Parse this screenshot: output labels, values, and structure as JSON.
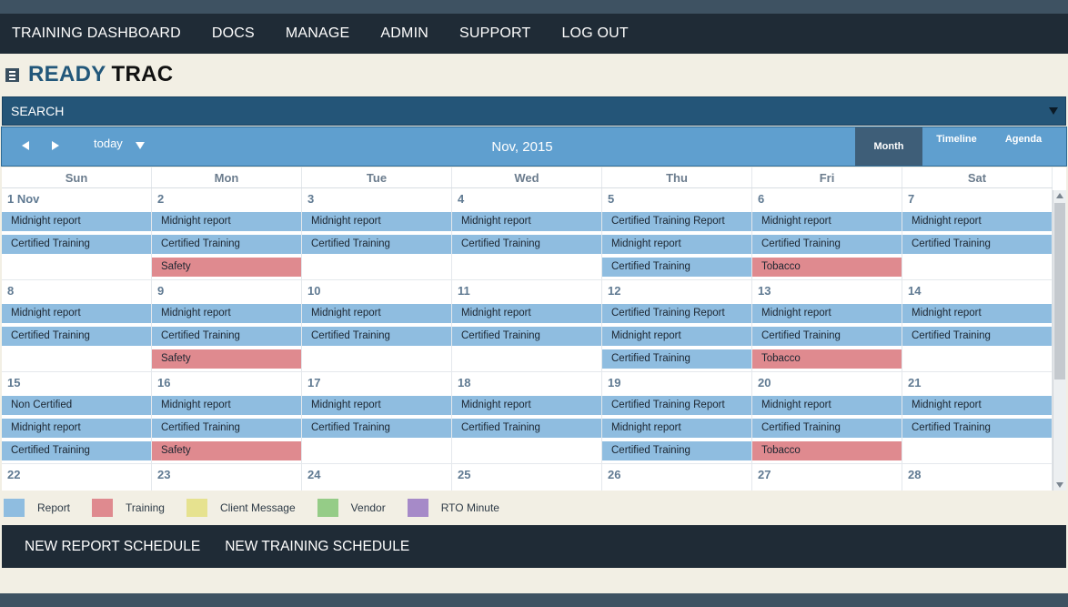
{
  "nav": {
    "items": [
      "TRAINING DASHBOARD",
      "DOCS",
      "MANAGE",
      "ADMIN",
      "SUPPORT",
      "LOG OUT"
    ]
  },
  "brand": {
    "part1": "READY",
    "part2": "TRAC"
  },
  "search": {
    "label": "SEARCH"
  },
  "toolbar": {
    "today_label": "today",
    "title": "Nov, 2015",
    "views": [
      "Month",
      "Timeline",
      "Agenda"
    ],
    "active_view": "Month"
  },
  "calendar": {
    "days_of_week": [
      "Sun",
      "Mon",
      "Tue",
      "Wed",
      "Thu",
      "Fri",
      "Sat"
    ],
    "weeks": [
      [
        {
          "num": "1 Nov",
          "events": [
            {
              "type": "report",
              "label": "Midnight report"
            },
            {
              "type": "report",
              "label": "Certified Training"
            }
          ]
        },
        {
          "num": "2",
          "events": [
            {
              "type": "report",
              "label": "Midnight report"
            },
            {
              "type": "report",
              "label": "Certified Training"
            },
            {
              "type": "training",
              "label": "Safety"
            }
          ]
        },
        {
          "num": "3",
          "events": [
            {
              "type": "report",
              "label": "Midnight report"
            },
            {
              "type": "report",
              "label": "Certified Training"
            }
          ]
        },
        {
          "num": "4",
          "events": [
            {
              "type": "report",
              "label": "Midnight report"
            },
            {
              "type": "report",
              "label": "Certified Training"
            }
          ]
        },
        {
          "num": "5",
          "events": [
            {
              "type": "report",
              "label": "Certified Training Report"
            },
            {
              "type": "report",
              "label": "Midnight report"
            },
            {
              "type": "report",
              "label": "Certified Training"
            }
          ]
        },
        {
          "num": "6",
          "events": [
            {
              "type": "report",
              "label": "Midnight report"
            },
            {
              "type": "report",
              "label": "Certified Training"
            },
            {
              "type": "training",
              "label": "Tobacco"
            }
          ]
        },
        {
          "num": "7",
          "events": [
            {
              "type": "report",
              "label": "Midnight report"
            },
            {
              "type": "report",
              "label": "Certified Training"
            }
          ]
        }
      ],
      [
        {
          "num": "8",
          "events": [
            {
              "type": "report",
              "label": "Midnight report"
            },
            {
              "type": "report",
              "label": "Certified Training"
            }
          ]
        },
        {
          "num": "9",
          "events": [
            {
              "type": "report",
              "label": "Midnight report"
            },
            {
              "type": "report",
              "label": "Certified Training"
            },
            {
              "type": "training",
              "label": "Safety"
            }
          ]
        },
        {
          "num": "10",
          "events": [
            {
              "type": "report",
              "label": "Midnight report"
            },
            {
              "type": "report",
              "label": "Certified Training"
            }
          ]
        },
        {
          "num": "11",
          "events": [
            {
              "type": "report",
              "label": "Midnight report"
            },
            {
              "type": "report",
              "label": "Certified Training"
            }
          ]
        },
        {
          "num": "12",
          "events": [
            {
              "type": "report",
              "label": "Certified Training Report"
            },
            {
              "type": "report",
              "label": "Midnight report"
            },
            {
              "type": "report",
              "label": "Certified Training"
            }
          ]
        },
        {
          "num": "13",
          "events": [
            {
              "type": "report",
              "label": "Midnight report"
            },
            {
              "type": "report",
              "label": "Certified Training"
            },
            {
              "type": "training",
              "label": "Tobacco"
            }
          ]
        },
        {
          "num": "14",
          "events": [
            {
              "type": "report",
              "label": "Midnight report"
            },
            {
              "type": "report",
              "label": "Certified Training"
            }
          ]
        }
      ],
      [
        {
          "num": "15",
          "events": [
            {
              "type": "report",
              "label": "Non Certified"
            },
            {
              "type": "report",
              "label": "Midnight report"
            },
            {
              "type": "report",
              "label": "Certified Training"
            }
          ]
        },
        {
          "num": "16",
          "events": [
            {
              "type": "report",
              "label": "Midnight report"
            },
            {
              "type": "report",
              "label": "Certified Training"
            },
            {
              "type": "training",
              "label": "Safety"
            }
          ]
        },
        {
          "num": "17",
          "events": [
            {
              "type": "report",
              "label": "Midnight report"
            },
            {
              "type": "report",
              "label": "Certified Training"
            }
          ]
        },
        {
          "num": "18",
          "events": [
            {
              "type": "report",
              "label": "Midnight report"
            },
            {
              "type": "report",
              "label": "Certified Training"
            }
          ]
        },
        {
          "num": "19",
          "events": [
            {
              "type": "report",
              "label": "Certified Training Report"
            },
            {
              "type": "report",
              "label": "Midnight report"
            },
            {
              "type": "report",
              "label": "Certified Training"
            }
          ]
        },
        {
          "num": "20",
          "events": [
            {
              "type": "report",
              "label": "Midnight report"
            },
            {
              "type": "report",
              "label": "Certified Training"
            },
            {
              "type": "training",
              "label": "Tobacco"
            }
          ]
        },
        {
          "num": "21",
          "events": [
            {
              "type": "report",
              "label": "Midnight report"
            },
            {
              "type": "report",
              "label": "Certified Training"
            }
          ]
        }
      ],
      [
        {
          "num": "22",
          "events": []
        },
        {
          "num": "23",
          "events": []
        },
        {
          "num": "24",
          "events": []
        },
        {
          "num": "25",
          "events": []
        },
        {
          "num": "26",
          "events": []
        },
        {
          "num": "27",
          "events": []
        },
        {
          "num": "28",
          "events": []
        }
      ]
    ]
  },
  "legend": [
    {
      "label": "Report",
      "color": "#8fbde0"
    },
    {
      "label": "Training",
      "color": "#df8a8f"
    },
    {
      "label": "Client Message",
      "color": "#e6e28f"
    },
    {
      "label": "Vendor",
      "color": "#95cc87"
    },
    {
      "label": "RTO Minute",
      "color": "#a68ac8"
    }
  ],
  "actions": {
    "new_report": "NEW REPORT SCHEDULE",
    "new_training": "NEW TRAINING SCHEDULE"
  }
}
